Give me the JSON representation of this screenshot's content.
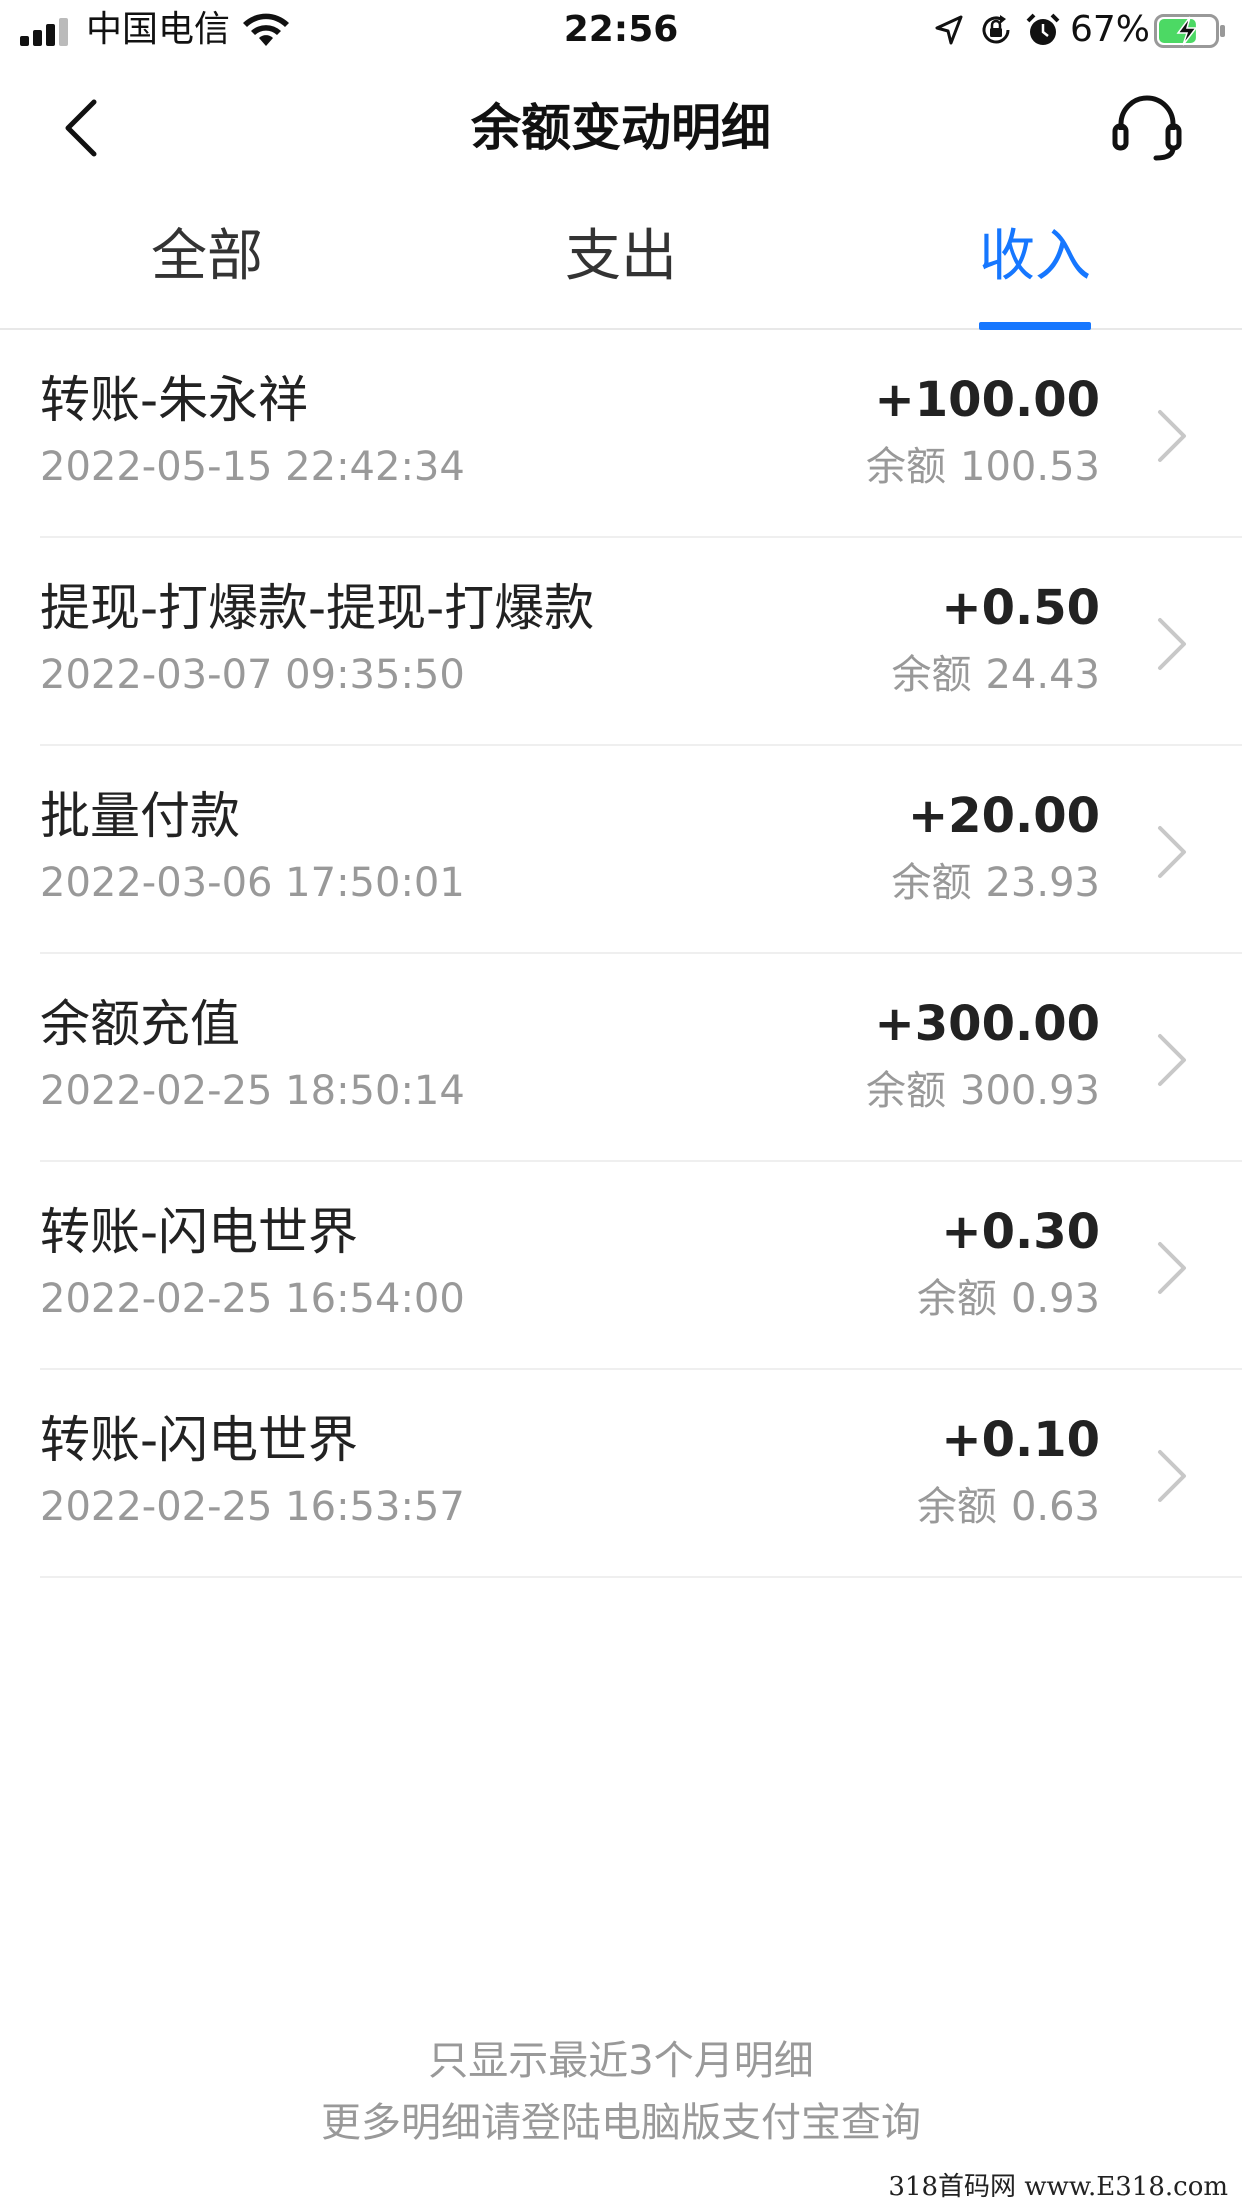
{
  "status_bar": {
    "carrier": "中国电信",
    "time": "22:56",
    "battery_percent": "67%",
    "battery_level": 0.67,
    "icons": [
      "signal-icon",
      "wifi-icon",
      "location-icon",
      "rotation-lock-icon",
      "alarm-icon",
      "battery-charging-icon"
    ]
  },
  "header": {
    "title": "余额变动明细",
    "back_icon": "chevron-left-icon",
    "service_icon": "headset-icon"
  },
  "tabs": [
    {
      "label": "全部",
      "active": false
    },
    {
      "label": "支出",
      "active": false
    },
    {
      "label": "收入",
      "active": true
    }
  ],
  "accent_color": "#1677ff",
  "transactions": [
    {
      "title": "转账-朱永祥",
      "time": "2022-05-15 22:42:34",
      "amount": "+100.00",
      "balance_label": "余额",
      "balance": "100.53"
    },
    {
      "title": "提现-打爆款-提现-打爆款",
      "time": "2022-03-07 09:35:50",
      "amount": "+0.50",
      "balance_label": "余额",
      "balance": "24.43"
    },
    {
      "title": "批量付款",
      "time": "2022-03-06 17:50:01",
      "amount": "+20.00",
      "balance_label": "余额",
      "balance": "23.93"
    },
    {
      "title": "余额充值",
      "time": "2022-02-25 18:50:14",
      "amount": "+300.00",
      "balance_label": "余额",
      "balance": "300.93"
    },
    {
      "title": "转账-闪电世界",
      "time": "2022-02-25 16:54:00",
      "amount": "+0.30",
      "balance_label": "余额",
      "balance": "0.93"
    },
    {
      "title": "转账-闪电世界",
      "time": "2022-02-25 16:53:57",
      "amount": "+0.10",
      "balance_label": "余额",
      "balance": "0.63"
    }
  ],
  "footer": {
    "line1": "只显示最近3个月明细",
    "line2": "更多明细请登陆电脑版支付宝查询"
  },
  "watermark": "318首码网 www.E318.com"
}
